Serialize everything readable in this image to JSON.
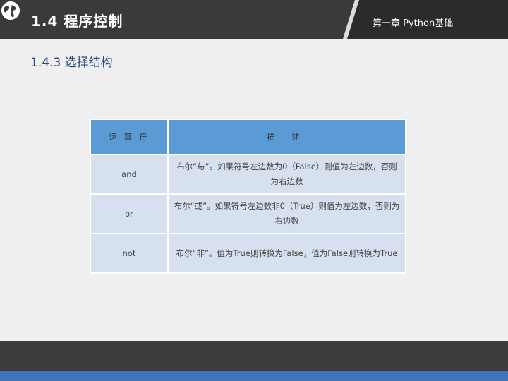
{
  "header": {
    "section_title": "1.4 程序控制",
    "chapter_label": "第一章 Python基础"
  },
  "subsection_title": "1.4.3 选择结构",
  "table": {
    "headers": [
      "运 算 符",
      "描 述"
    ],
    "rows": [
      {
        "operator": "and",
        "description": "布尔“与”。如果符号左边数为0（False）则值为左边数，否则为右边数"
      },
      {
        "operator": "or",
        "description": "布尔“或”。如果符号左边数非0（True）则值为左边数，否则为右边数"
      },
      {
        "operator": "not",
        "description": "布尔“非”。值为True则转换为False，值为False则转换为True"
      }
    ]
  },
  "colors": {
    "header_bg": "#3a3a3a",
    "header_accent": "#2a2a2a",
    "table_header": "#5b9bd5",
    "table_cell": "#d6e0ef",
    "footer_bg": "#3c3c3c",
    "footer_line": "#3d76b8"
  }
}
